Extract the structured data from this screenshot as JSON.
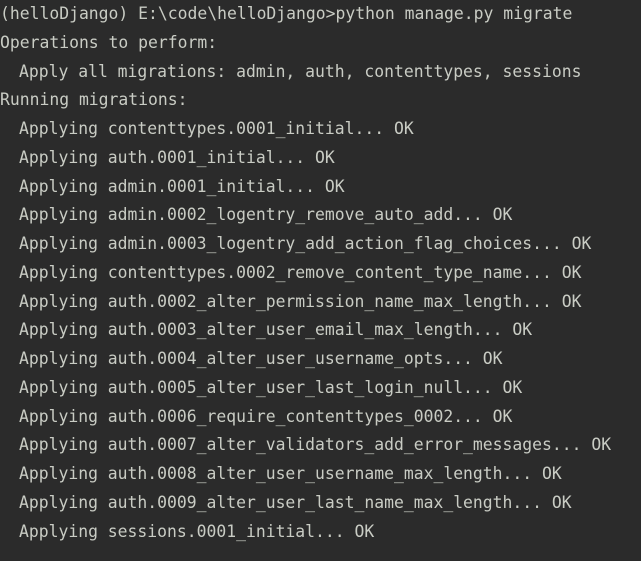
{
  "terminal": {
    "prompt_line": "(helloDjango) E:\\code\\helloDjango>python manage.py migrate",
    "operations_header": "Operations to perform:",
    "apply_line": "Apply all migrations: admin, auth, contenttypes, sessions",
    "running_header": "Running migrations:",
    "migrations": [
      "Applying contenttypes.0001_initial... OK",
      "Applying auth.0001_initial... OK",
      "Applying admin.0001_initial... OK",
      "Applying admin.0002_logentry_remove_auto_add... OK",
      "Applying admin.0003_logentry_add_action_flag_choices... OK",
      "Applying contenttypes.0002_remove_content_type_name... OK",
      "Applying auth.0002_alter_permission_name_max_length... OK",
      "Applying auth.0003_alter_user_email_max_length... OK",
      "Applying auth.0004_alter_user_username_opts... OK",
      "Applying auth.0005_alter_user_last_login_null... OK",
      "Applying auth.0006_require_contenttypes_0002... OK",
      "Applying auth.0007_alter_validators_add_error_messages... OK",
      "Applying auth.0008_alter_user_username_max_length... OK",
      "Applying auth.0009_alter_user_last_name_max_length... OK",
      "Applying sessions.0001_initial... OK"
    ]
  },
  "colors": {
    "background": "#2b2b2b",
    "text": "#c9ccc4"
  }
}
